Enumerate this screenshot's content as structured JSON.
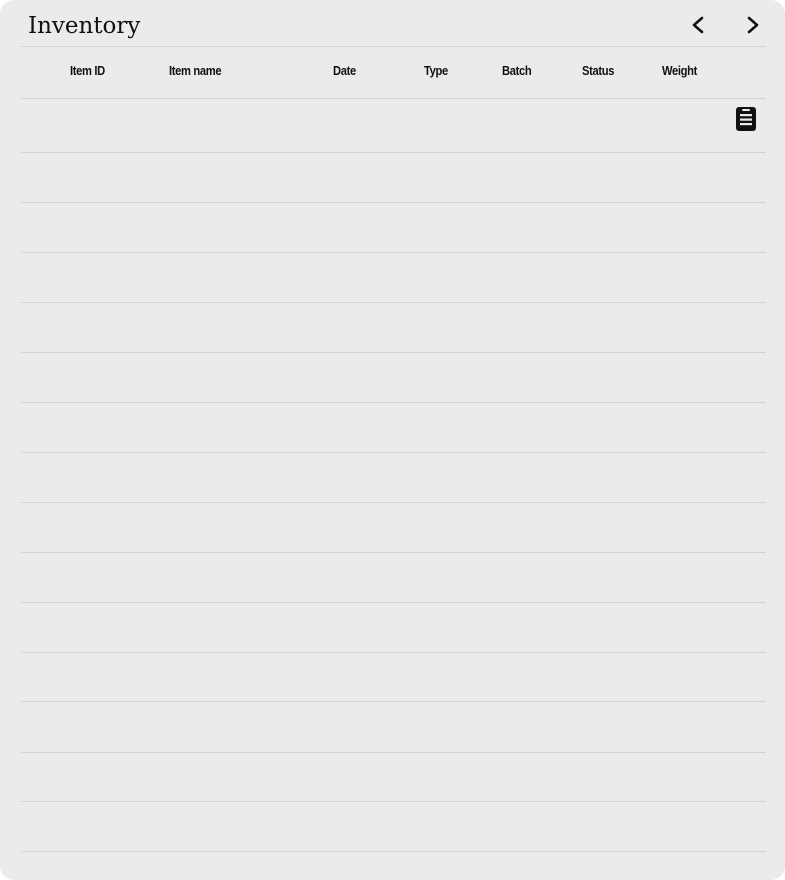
{
  "header": {
    "title": "Inventory",
    "prev_icon": "chevron-left-icon",
    "next_icon": "chevron-right-icon"
  },
  "table": {
    "columns": [
      "Item ID",
      "Item name",
      "Date",
      "Type",
      "Batch",
      "Status",
      "Weight"
    ],
    "row_count": 15,
    "row_action_icon": "document-list-icon"
  },
  "colors": {
    "panel_background": "#ebebeb",
    "rule": "#d2d2d2",
    "text": "#111111"
  }
}
